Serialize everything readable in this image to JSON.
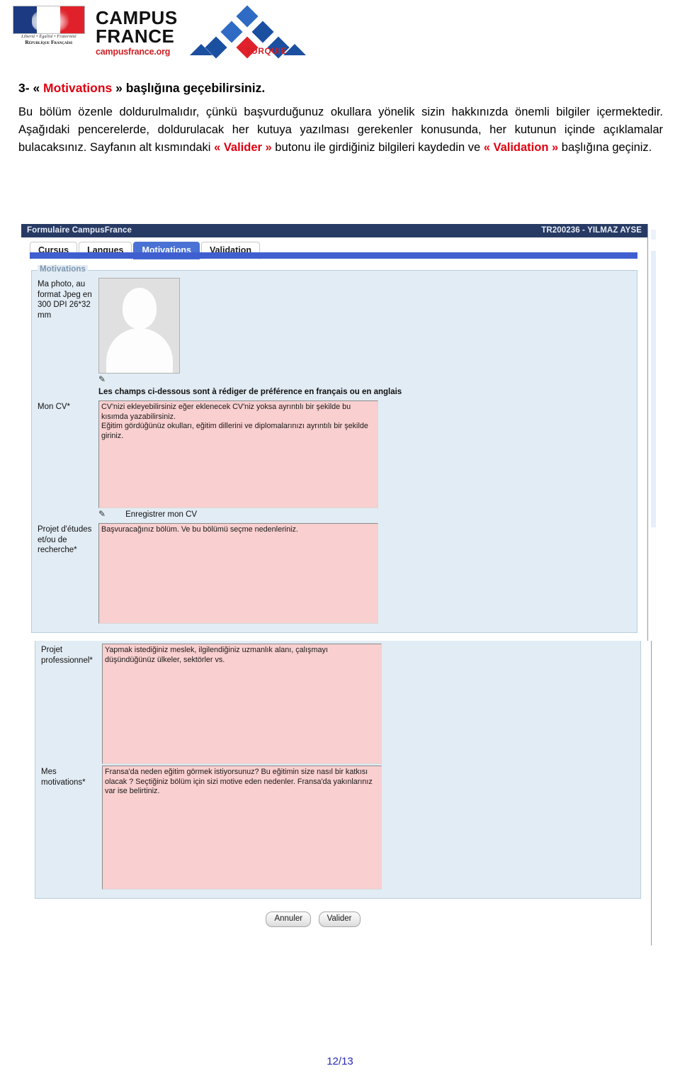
{
  "logo": {
    "flag_devise": "Liberté • Égalité • Fraternité",
    "flag_republic": "République Française",
    "campus": "CAMPUS",
    "france": "FRANCE",
    "url": "campusfrance.org",
    "country": "TURQUIE"
  },
  "instructions": {
    "step_number": "3-",
    "quote_open": "«",
    "heading_keyword": "Motivations",
    "quote_close": "»",
    "heading_rest": "başlığına geçebilirsiniz.",
    "para_1": "Bu bölüm özenle doldurulmalıdır, çünkü başvurduğunuz okullara yönelik sizin hakkınızda önemli bilgiler içermektedir. Aşağıdaki pencerelerde, doldurulacak her kutuya yazılması gerekenler konusunda, her kutunun içinde açıklamalar bulacaksınız. Sayfanın alt kısmındaki ",
    "para_1_kw1": "« Valider »",
    "para_2": " butonu ile girdiğiniz bilgileri kaydedin ve ",
    "para_1_kw2": "« Validation »",
    "para_3": " başlığına geçiniz."
  },
  "screenshot": {
    "titlebar": {
      "app_title": "Formulaire CampusFrance",
      "user": "TR200236 - YILMAZ AYSE"
    },
    "tabs": [
      {
        "label": "Cursus",
        "active": false
      },
      {
        "label": "Langues",
        "active": false
      },
      {
        "label": "Motivations",
        "active": true
      },
      {
        "label": "Validation",
        "active": false
      }
    ],
    "fieldset_legend": "Motivations",
    "photo": {
      "label": "Ma photo, au format Jpeg en 300 DPI 26*32 mm",
      "attach_icon": "pencil-attach-icon"
    },
    "notice": "Les champs ci-dessous sont à rédiger de préférence en français ou en anglais",
    "fields": [
      {
        "label": "Mon CV*",
        "value": "CV'nizi ekleyebilirsiniz eğer eklenecek CV'niz yoksa ayrıntılı bir şekilde bu kısımda yazabilirsiniz.\nEğitim gördüğünüz okulları, eğitim dillerini ve diplomalarınızı ayrıntılı bir şekilde giriniz."
      },
      {
        "label": "Projet d'études et/ou de recherche*",
        "value": "Başvuracağınız bölüm. Ve bu bölümü seçme nedenleriniz."
      },
      {
        "label": "Projet professionnel*",
        "value": "Yapmak istediğiniz meslek, ilgilendiğiniz uzmanlık alanı, çalışmayı düşündüğünüz ülkeler, sektörler vs."
      },
      {
        "label": "Mes motivations*",
        "value": "Fransa'da neden eğitim görmek istiyorsunuz? Bu eğitimin size nasıl bir katkısı olacak ? Seçtiğiniz bölüm için sizi motive eden nedenler. Fransa'da yakınlarınız var ise belirtiniz."
      }
    ],
    "save_cv": {
      "icon": "pencil-attach-icon",
      "label": "Enregistrer mon CV"
    },
    "buttons": {
      "cancel": "Annuler",
      "validate": "Valider"
    }
  },
  "footer": {
    "page": "12/13"
  },
  "colors": {
    "accent_red": "#e0000f",
    "titlebar_navy": "#273a63",
    "tab_active_blue": "#4a72d4",
    "fieldset_blue": "#e2ecf4",
    "textarea_pink": "#f9cfcf",
    "page_number_blue": "#2a2ab8"
  }
}
